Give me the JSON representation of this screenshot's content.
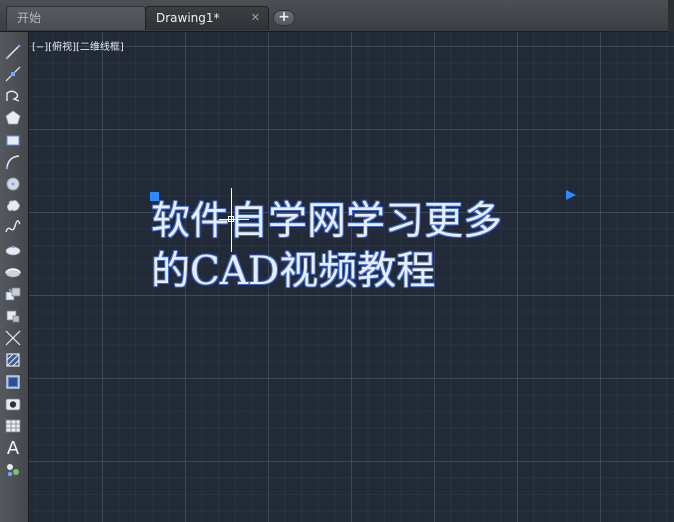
{
  "tabs": [
    {
      "label": "开始",
      "active": false
    },
    {
      "label": "Drawing1*",
      "active": true,
      "close_icon": "close-icon"
    }
  ],
  "new_tab_label": "+",
  "viewport_label": "[−][俯视][二维线框]",
  "toolbar": {
    "tools": [
      "line-icon",
      "construction-line-icon",
      "polyline-icon",
      "polygon-icon",
      "rectangle-icon",
      "arc-icon",
      "circle-icon",
      "revision-cloud-icon",
      "spline-icon",
      "ellipse-icon",
      "ellipse-arc-icon",
      "insert-block-icon",
      "make-block-icon",
      "point-icon",
      "hatch-icon",
      "gradient-icon",
      "region-icon",
      "table-icon",
      "multiline-text-icon",
      "add-selected-icon"
    ],
    "text_tool_label": "A"
  },
  "canvas": {
    "mtext_lines": [
      "软件自学网学习更多",
      "的CAD视频教程"
    ],
    "colors": {
      "background": "#222a37",
      "text_fill": "#e7eeff",
      "text_outline": "#3c63c0",
      "grip": "#2b8bff"
    }
  }
}
